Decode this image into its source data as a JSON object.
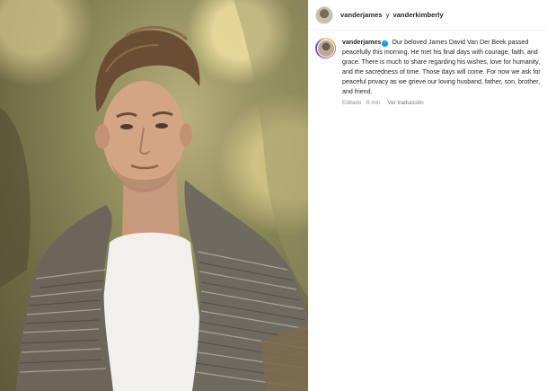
{
  "header": {
    "user_a": "vanderjames",
    "conjunction": "y",
    "user_b": "vanderkimberly"
  },
  "post": {
    "username": "vanderjames",
    "verified_icon": "verified-check-icon",
    "caption": "Our beloved James David Van Der Beek passed peacefully this morning. He met his final days with courage, faith, and grace. There is much to share regarding his wishes, love for humanity, and the sacredness of time. Those days will come. For now we ask for peaceful privacy as we grieve our loving husband, father, son, brother, and friend.",
    "edited_time": "Editado · 8 min",
    "translate_link": "Ver traducción"
  },
  "colors": {
    "link_blue": "#0095f6",
    "muted_text": "#8e8e8e",
    "divider": "#dbdbdb"
  }
}
